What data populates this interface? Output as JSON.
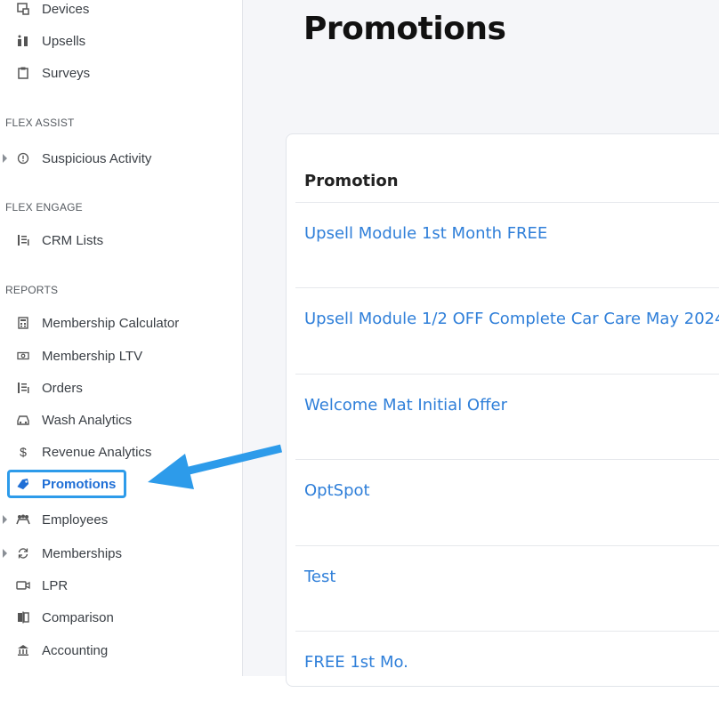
{
  "sidebar": {
    "top_items": [
      {
        "label": "Devices",
        "icon": "devices-icon"
      },
      {
        "label": "Upsells",
        "icon": "upsells-icon"
      },
      {
        "label": "Surveys",
        "icon": "clipboard-icon"
      }
    ],
    "sections": {
      "flex_assist": "FLEX ASSIST",
      "flex_engage": "FLEX ENGAGE",
      "reports": "REPORTS"
    },
    "flex_assist_items": [
      {
        "label": "Suspicious Activity",
        "icon": "alert-circle-icon"
      }
    ],
    "flex_engage_items": [
      {
        "label": "CRM Lists",
        "icon": "list-icon"
      }
    ],
    "report_items": [
      {
        "label": "Membership Calculator",
        "icon": "calculator-icon"
      },
      {
        "label": "Membership LTV",
        "icon": "money-icon"
      },
      {
        "label": "Orders",
        "icon": "list-icon"
      },
      {
        "label": "Wash Analytics",
        "icon": "car-icon"
      },
      {
        "label": "Revenue Analytics",
        "icon": "dollar-icon"
      },
      {
        "label": "Promotions",
        "icon": "tag-icon",
        "active": true
      },
      {
        "label": "Employees",
        "icon": "people-icon"
      },
      {
        "label": "Memberships",
        "icon": "refresh-icon"
      },
      {
        "label": "LPR",
        "icon": "camera-icon"
      },
      {
        "label": "Comparison",
        "icon": "comparison-icon"
      },
      {
        "label": "Accounting",
        "icon": "bank-icon"
      }
    ]
  },
  "main": {
    "title": "Promotions",
    "table": {
      "header": "Promotion",
      "rows": [
        "Upsell Module 1st Month FREE",
        "Upsell Module 1/2 OFF Complete Car Care May 2024",
        "Welcome Mat Initial Offer",
        "OptSpot",
        "Test",
        "FREE 1st Mo."
      ]
    }
  },
  "colors": {
    "accent": "#2f7fd9",
    "highlight": "#2d9bea",
    "background": "#f5f6f9"
  }
}
